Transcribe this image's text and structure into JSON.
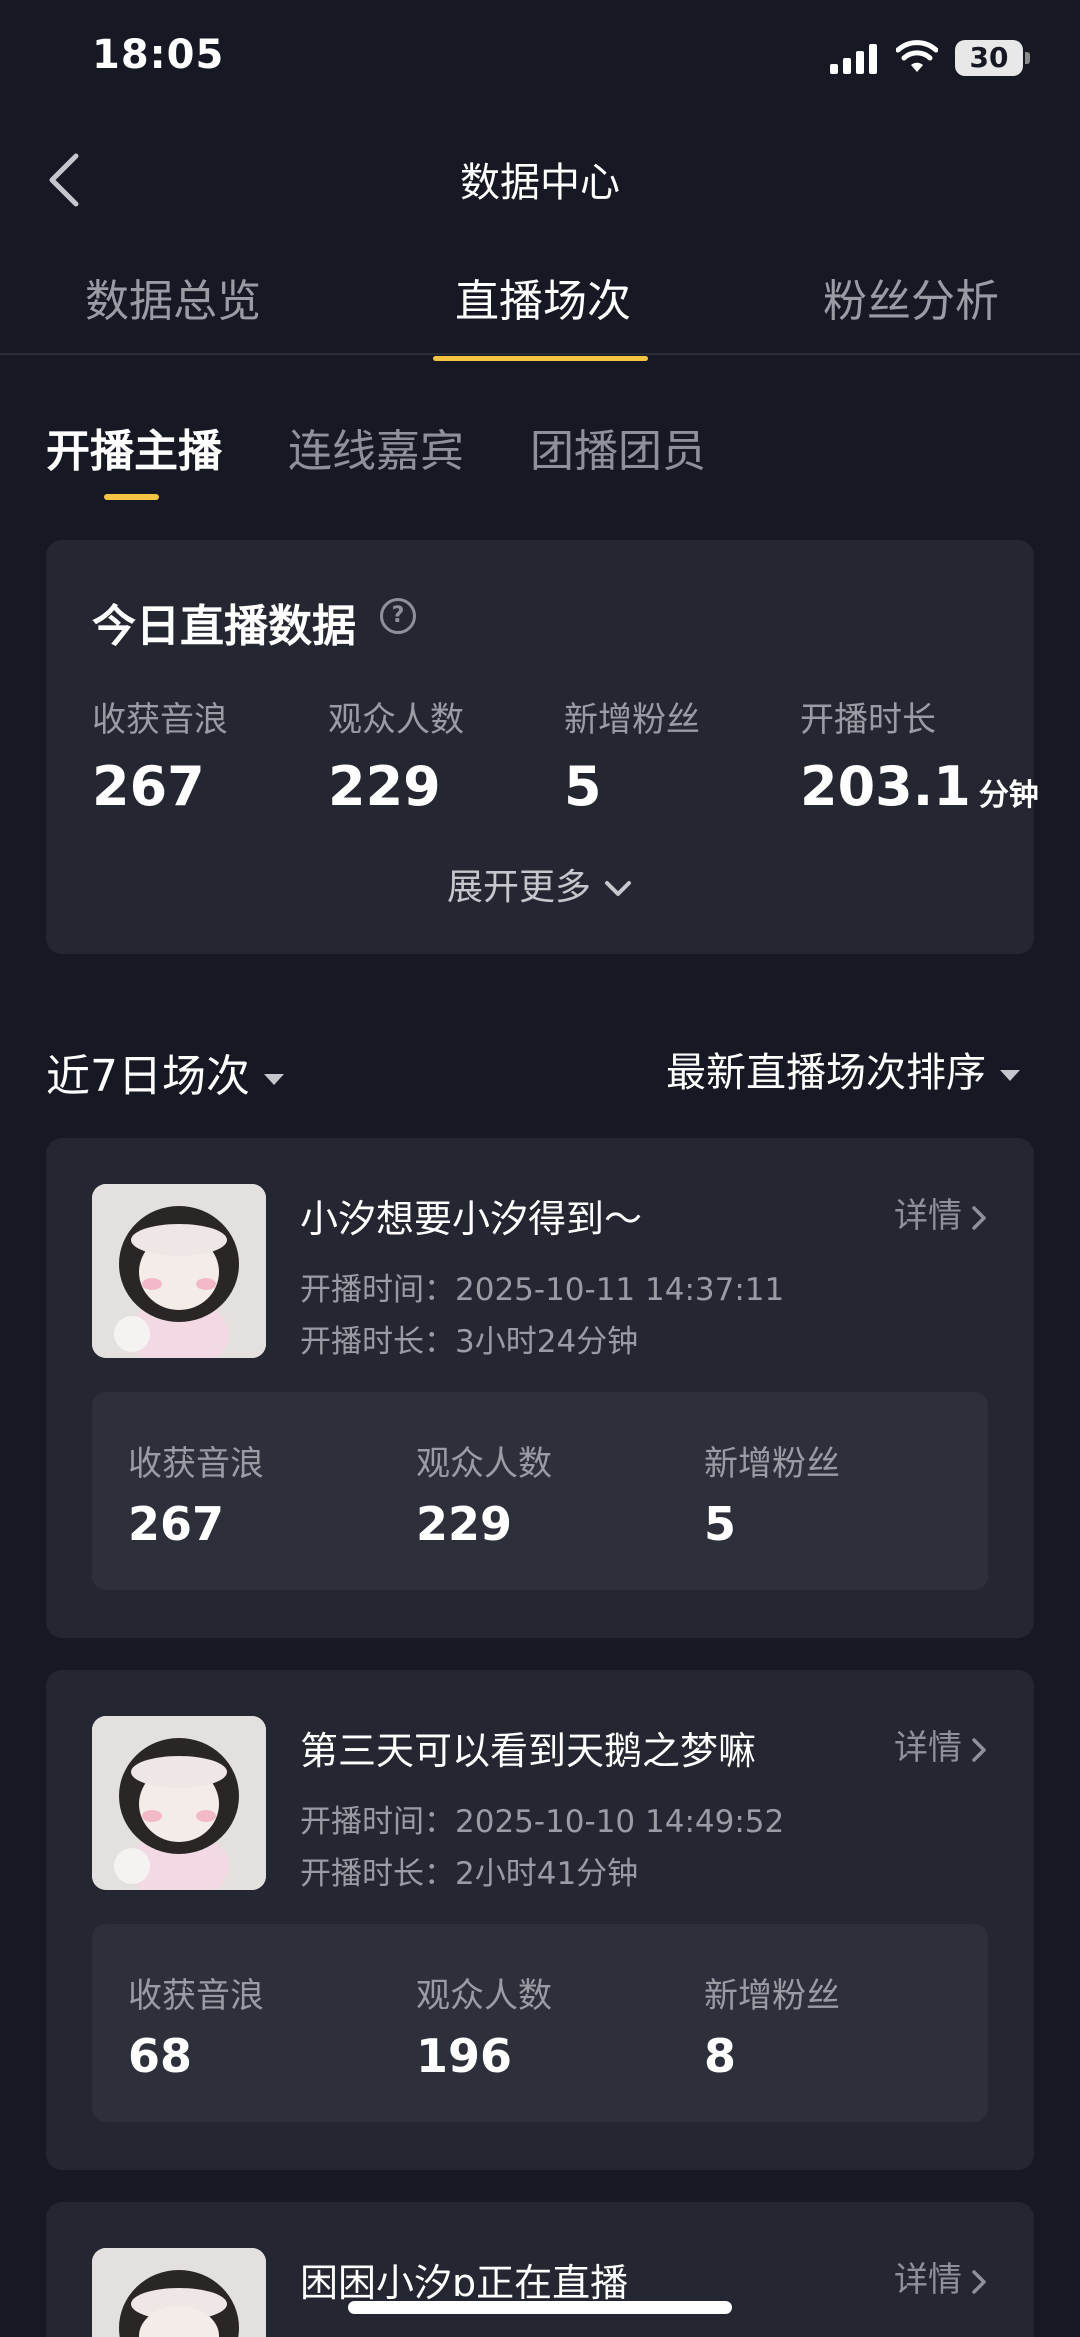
{
  "status_bar": {
    "time": "18:05",
    "battery": "30"
  },
  "header": {
    "title": "数据中心"
  },
  "tabs": [
    {
      "label": "数据总览"
    },
    {
      "label": "直播场次"
    },
    {
      "label": "粉丝分析"
    }
  ],
  "subtabs": [
    {
      "label": "开播主播"
    },
    {
      "label": "连线嘉宾"
    },
    {
      "label": "团播团员"
    }
  ],
  "today": {
    "title": "今日直播数据",
    "help_glyph": "?",
    "stats": [
      {
        "label": "收获音浪",
        "value": "267",
        "unit": ""
      },
      {
        "label": "观众人数",
        "value": "229",
        "unit": ""
      },
      {
        "label": "新增粉丝",
        "value": "5",
        "unit": ""
      },
      {
        "label": "开播时长",
        "value": "203.1",
        "unit": "分钟"
      }
    ],
    "expand_label": "展开更多"
  },
  "filters": {
    "range": "近7日场次",
    "sort": "最新直播场次排序"
  },
  "sessions": [
    {
      "title": "小汐想要小汐得到～",
      "detail_label": "详情",
      "start_label": "开播时间：",
      "start_value": "2025-10-11 14:37:11",
      "duration_label": "开播时长：",
      "duration_value": "3小时24分钟",
      "stats": [
        {
          "label": "收获音浪",
          "value": "267"
        },
        {
          "label": "观众人数",
          "value": "229"
        },
        {
          "label": "新增粉丝",
          "value": "5"
        }
      ]
    },
    {
      "title": "第三天可以看到天鹅之梦嘛",
      "detail_label": "详情",
      "start_label": "开播时间：",
      "start_value": "2025-10-10 14:49:52",
      "duration_label": "开播时长：",
      "duration_value": "2小时41分钟",
      "stats": [
        {
          "label": "收获音浪",
          "value": "68"
        },
        {
          "label": "观众人数",
          "value": "196"
        },
        {
          "label": "新增粉丝",
          "value": "8"
        }
      ]
    },
    {
      "title": "困困小汐ɒ正在直播",
      "detail_label": "详情"
    }
  ],
  "colors": {
    "background": "#161823",
    "card": "#242631",
    "accent": "#f6c443",
    "muted": "#9a9ba3"
  },
  "icons": [
    "signal-icon",
    "wifi-icon",
    "battery-icon",
    "back-arrow-icon",
    "help-icon",
    "chevron-down-icon",
    "chevron-right-icon",
    "caret-down-icon"
  ]
}
